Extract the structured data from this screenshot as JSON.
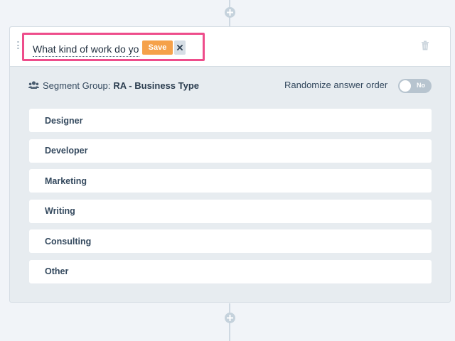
{
  "question": {
    "value": "What kind of work do you do?",
    "save_label": "Save",
    "cancel_glyph": "×"
  },
  "segment": {
    "label": "Segment Group:",
    "value": "RA - Business Type"
  },
  "randomize": {
    "label": "Randomize answer order",
    "toggle_text": "No"
  },
  "answers": [
    "Designer",
    "Developer",
    "Marketing",
    "Writing",
    "Consulting",
    "Other"
  ],
  "colors": {
    "highlight": "#ee4d8b",
    "save": "#f5a14a",
    "background": "#e7ecf0"
  },
  "icons": [
    "plus-icon",
    "drag-handle-icon",
    "close-icon",
    "trash-icon",
    "users-icon"
  ]
}
